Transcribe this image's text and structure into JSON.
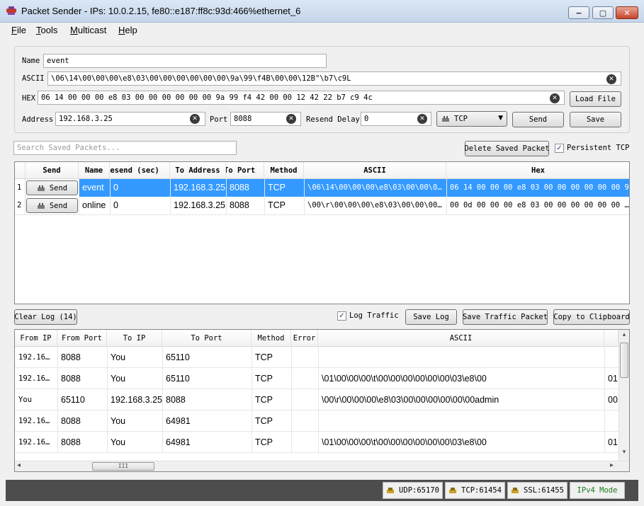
{
  "window": {
    "title": "Packet Sender - IPs: 10.0.2.15, fe80::e187:ff8c:93d:466%ethernet_6",
    "minimize_glyph": "−",
    "maximize_glyph": "▢",
    "close_glyph": "✕"
  },
  "menu": [
    "File",
    "Tools",
    "Multicast",
    "Help"
  ],
  "form": {
    "name_label": "Name",
    "name_value": "event",
    "ascii_label": "ASCII",
    "ascii_value": "\\06\\14\\00\\00\\00\\e8\\03\\00\\00\\00\\00\\00\\00\\9a\\99\\f4B\\00\\00\\12B\"\\b7\\c9L",
    "hex_label": "HEX",
    "hex_value": "06 14 00 00 00 e8 03 00 00 00 00 00 00 9a 99 f4 42 00 00 12 42 22 b7 c9 4c",
    "load_file": "Load File",
    "address_label": "Address",
    "address_value": "192.168.3.25",
    "port_label": "Port",
    "port_value": "8088",
    "resend_label": "Resend Delay",
    "resend_value": "0",
    "protocol": "TCP",
    "send": "Send",
    "save": "Save",
    "clear_glyph": "✕"
  },
  "saved": {
    "search_placeholder": "Search Saved Packets...",
    "delete_button": "Delete Saved Packet",
    "persistent_tcp": "Persistent TCP",
    "persistent_checked": "✓",
    "headers": [
      "Send",
      "Name",
      "Resend (sec)",
      "To Address",
      "To Port",
      "Method",
      "ASCII",
      "Hex"
    ],
    "row_send_label": "Send",
    "rows": [
      {
        "num": "1",
        "name": "event",
        "resend": "0",
        "address": "192.168.3.25",
        "port": "8088",
        "method": "TCP",
        "ascii": "\\06\\14\\00\\00\\00\\e8\\03\\00\\00\\0…",
        "hex": "06 14 00 00 00 e8 03 00 00 00 00 00 00 9…",
        "selected": true
      },
      {
        "num": "2",
        "name": "online",
        "resend": "0",
        "address": "192.168.3.25",
        "port": "8088",
        "method": "TCP",
        "ascii": "\\00\\r\\00\\00\\00\\e8\\03\\00\\00\\00…",
        "hex": "00 0d 00 00 00 e8 03 00 00 00 00 00 00 …",
        "selected": false
      }
    ]
  },
  "log": {
    "clear_button": "Clear Log (14)",
    "log_traffic": "Log Traffic",
    "log_checked": "✓",
    "save_log": "Save Log",
    "save_traffic": "Save Traffic Packet",
    "copy_clipboard": "Copy to Clipboard",
    "headers": [
      "From IP",
      "From Port",
      "To IP",
      "To Port",
      "Method",
      "Error",
      "ASCII"
    ],
    "rows": [
      {
        "from_ip": "192.16…",
        "from_port": "8088",
        "to_ip": "You",
        "to_port": "65110",
        "method": "TCP",
        "error": "",
        "ascii": "",
        "hex": ""
      },
      {
        "from_ip": "192.16…",
        "from_port": "8088",
        "to_ip": "You",
        "to_port": "65110",
        "method": "TCP",
        "error": "",
        "ascii": "\\01\\00\\00\\00\\t\\00\\00\\00\\00\\00\\00\\03\\e8\\00",
        "hex": "01"
      },
      {
        "from_ip": "You",
        "from_port": "65110",
        "to_ip": "192.168.3.25",
        "to_port": "8088",
        "method": "TCP",
        "error": "",
        "ascii": "\\00\\r\\00\\00\\00\\e8\\03\\00\\00\\00\\00\\00\\00admin",
        "hex": "00"
      },
      {
        "from_ip": "192.16…",
        "from_port": "8088",
        "to_ip": "You",
        "to_port": "64981",
        "method": "TCP",
        "error": "",
        "ascii": "",
        "hex": ""
      },
      {
        "from_ip": "192.16…",
        "from_port": "8088",
        "to_ip": "You",
        "to_port": "64981",
        "method": "TCP",
        "error": "",
        "ascii": "\\01\\00\\00\\00\\t\\00\\00\\00\\00\\00\\00\\03\\e8\\00",
        "hex": "01"
      }
    ],
    "hscroll_grip": "III",
    "left_arrow": "◂",
    "right_arrow": "▸",
    "up_arrow": "▴",
    "down_arrow": "▾"
  },
  "status": {
    "udp": "UDP:65170",
    "tcp": "TCP:61454",
    "ssl": "SSL:61455",
    "mode": "IPv4 Mode"
  },
  "colors": {
    "selection": "#3399ff",
    "mode_text": "#1a7a1a",
    "statusbar": "#4d4d4d"
  }
}
